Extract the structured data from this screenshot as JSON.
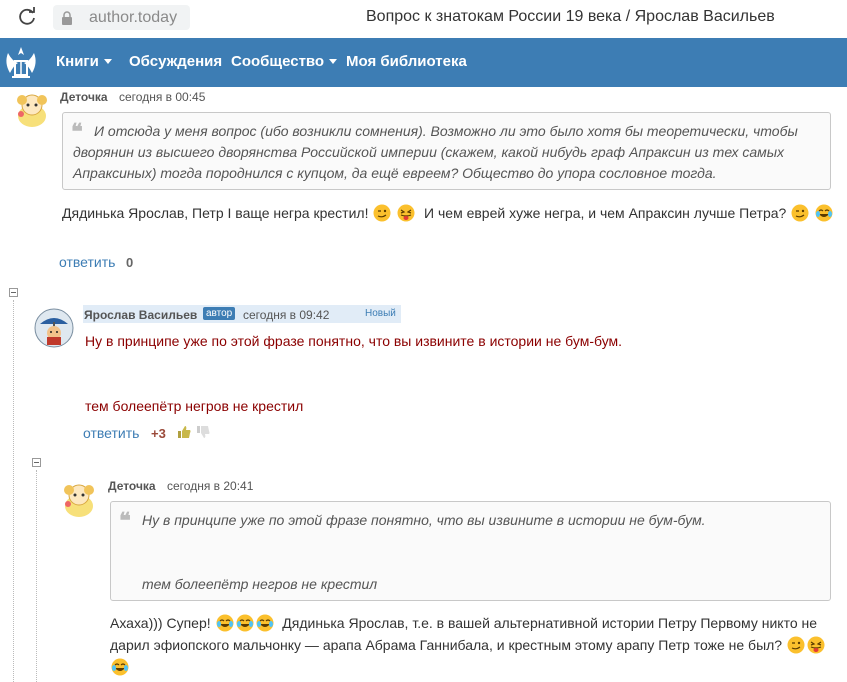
{
  "browser": {
    "address": "author.today",
    "title": "Вопрос к знатокам России 19 века / Ярослав Васильев"
  },
  "nav": {
    "items": [
      "Книги",
      "Обсуждения",
      "Сообщество",
      "Моя библиотека"
    ]
  },
  "colors": {
    "brand": "#3d7db4",
    "highlight": "#e1ecf7",
    "dark_text": "#8b0000"
  },
  "comments": [
    {
      "author": "Деточка",
      "date": "сегодня в 00:45",
      "quote": "Ио отсюда у меня вопрос (ибо возникли сомнения). Возможно ли это было хотя бы теоретически, чтобы дворянин из высшего дворянства Российской империи (скажем, какой нибудь граф Апраксин из тех самых Апраксиных) тогда породнился с купцом, да ещё евреем? Общество до упора сословное тогда.",
      "quote_lines": [
        "И отсюда у меня вопрос (ибо возникли сомнения). Возможно ли это было хотя бы теоретически, чтобы",
        "дворянин из высшего дворянства Российской империи (скажем, какой нибудь граф Апраксин из тех самых",
        "Апраксиных) тогда породнился с купцом, да ещё евреем? Общество до упора сословное тогда."
      ],
      "text_a": "Дядинька Ярослав, Петр I ваще негра крестил!",
      "text_b": "И чем еврей хуже негра, и чем Апраксин лучше Петра?",
      "reply": "ответить",
      "score": "0"
    },
    {
      "author": "Ярослав Васильев",
      "badge": "автор",
      "date": "сегодня в 09:42",
      "new_label": "Новый",
      "line1": "Ну в принципе уже по этой фразе понятно, что вы извините в истории не бум-бум.",
      "line2": "тем болеепётр негров не крестил",
      "reply": "ответить",
      "score": "+3"
    },
    {
      "author": "Деточка",
      "date": "сегодня в 20:41",
      "quote_line1": "Ну в принципе уже по этой фразе понятно, что вы извините в истории не бум-бум.",
      "quote_line2": "тем болеепётр негров не крестил",
      "text_a": "Ахаха))) Супер!",
      "text_b": "Дядинька Ярослав, т.е. в вашей альтернативной истории Петру Первому никто не",
      "text_c": "дарил эфиопского мальчонку — арапа Абрама Ганнибала, и крестным этому арапу Петр тоже не был?"
    }
  ]
}
